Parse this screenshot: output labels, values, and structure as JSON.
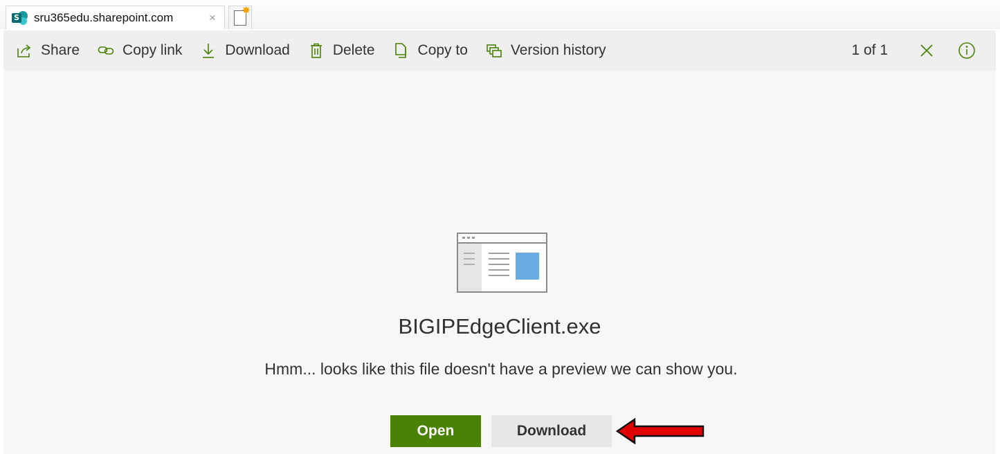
{
  "browser": {
    "tab_title": "sru365edu.sharepoint.com",
    "tab_close": "×",
    "favicon_letter": "S",
    "new_tab_icon": "new-tab-icon"
  },
  "toolbar": {
    "items": [
      {
        "label": "Share",
        "icon": "share-icon"
      },
      {
        "label": "Copy link",
        "icon": "link-icon"
      },
      {
        "label": "Download",
        "icon": "download-icon"
      },
      {
        "label": "Delete",
        "icon": "trash-icon"
      },
      {
        "label": "Copy to",
        "icon": "copy-icon"
      },
      {
        "label": "Version history",
        "icon": "version-history-icon"
      }
    ],
    "counter": "1 of 1",
    "close_icon": "close-icon",
    "info_icon": "info-icon",
    "accent_color": "#498205"
  },
  "preview": {
    "file_icon": "generic-file-preview-icon",
    "filename": "BIGIPEdgeClient.exe",
    "message": "Hmm... looks like this file doesn't have a preview we can show you.",
    "open_label": "Open",
    "download_label": "Download",
    "open_button_color": "#498205",
    "annotation": "red-arrow-icon",
    "annotation_color": "#e00000"
  }
}
